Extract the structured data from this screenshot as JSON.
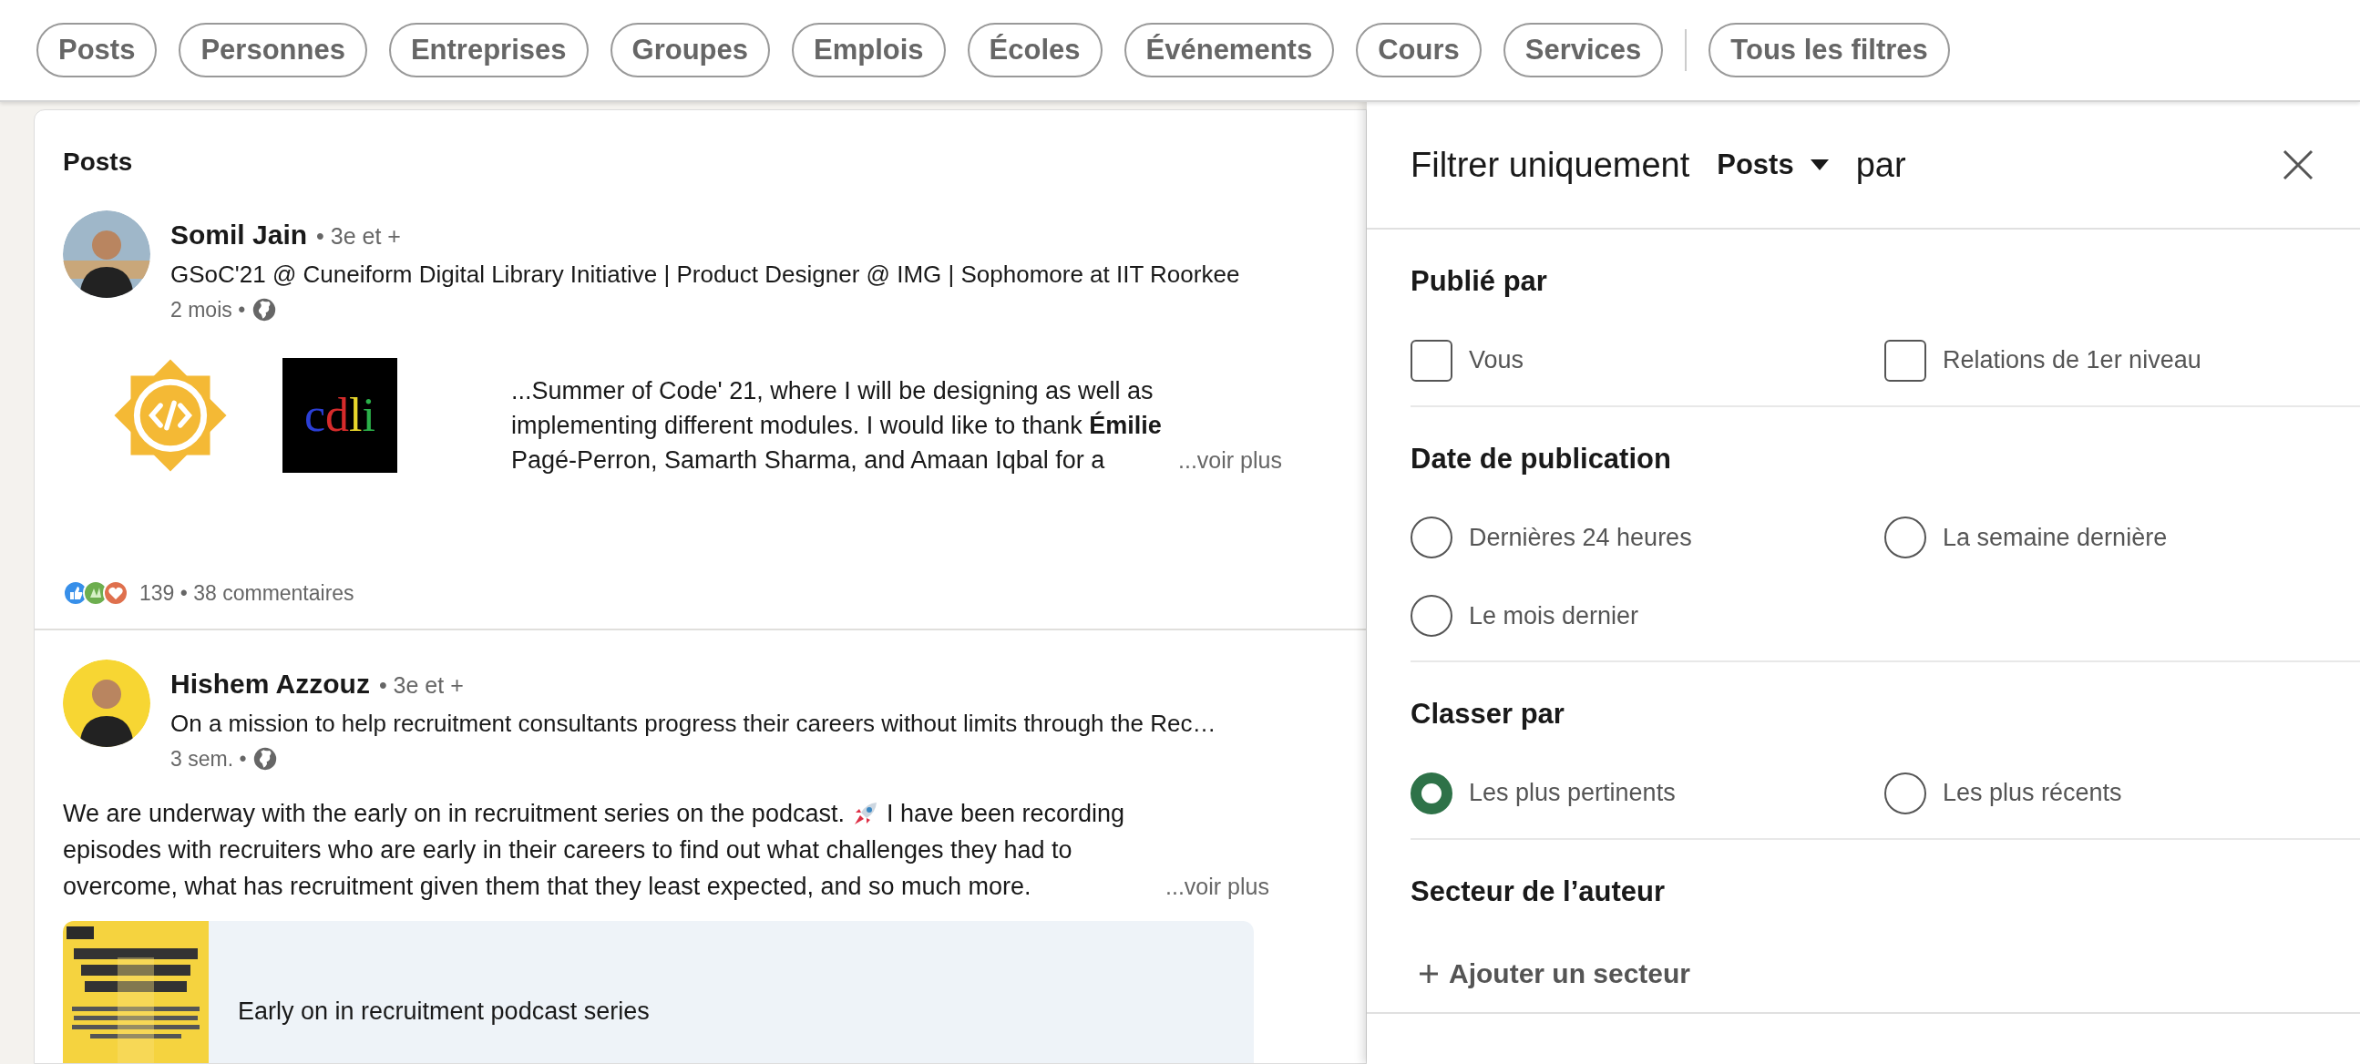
{
  "filter_bar": {
    "pills": [
      "Posts",
      "Personnes",
      "Entreprises",
      "Groupes",
      "Emplois",
      "Écoles",
      "Événements",
      "Cours",
      "Services"
    ],
    "all_filters": "Tous les filtres"
  },
  "results": {
    "heading": "Posts",
    "posts": [
      {
        "kind": "media",
        "author": "Somil Jain",
        "degree": "• 3e et +",
        "headline": "GSoC'21 @ Cuneiform Digital Library Initiative | Product Designer @ IMG | Sophomore at IIT Roorkee",
        "time": "2 mois •",
        "logo_letters": [
          {
            "char": "c",
            "color": "#2b3fd6"
          },
          {
            "char": "d",
            "color": "#d62b2b"
          },
          {
            "char": "l",
            "color": "#e8d62b"
          },
          {
            "char": "i",
            "color": "#2bb04a"
          }
        ],
        "body": "...Summer of Code' 21, where I will be designing as well as implementing different modules. I would like to thank **Émilie**  Pagé-Perron, Samarth Sharma, and Amaan Iqbal for a",
        "more": "...voir plus",
        "social": "139 • 38 commentaires"
      },
      {
        "kind": "link",
        "author": "Hishem Azzouz",
        "degree": "• 3e et +",
        "headline": "On a mission to help recruitment consultants progress their careers without limits through the Rec…",
        "time": "3 sem. •",
        "body": "We are underway with the early on in recruitment series on the podcast.",
        "body_mid": "I have been recording",
        "body_after": "episodes with recruiters who are early in their careers to find out what challenges they had to overcome, what has recruitment given them that they least expected, and so much more.",
        "more": "...voir plus",
        "card_title": "Early on in recruitment podcast series"
      }
    ]
  },
  "filter_panel": {
    "title": "Filtrer uniquement",
    "type_dropdown": "Posts",
    "title_after": "par",
    "sections": [
      {
        "kind": "checkbox",
        "title": "Publié par",
        "options": [
          {
            "label": "Vous",
            "checked": false
          },
          {
            "label": "Relations de 1er niveau",
            "checked": false
          }
        ]
      },
      {
        "kind": "radio",
        "title": "Date de publication",
        "options": [
          {
            "label": "Dernières 24 heures",
            "selected": false
          },
          {
            "label": "La semaine dernière",
            "selected": false
          },
          {
            "label": "Le mois dernier",
            "selected": false
          }
        ]
      },
      {
        "kind": "radio",
        "title": "Classer par",
        "options": [
          {
            "label": "Les plus pertinents",
            "selected": true
          },
          {
            "label": "Les plus récents",
            "selected": false
          }
        ]
      },
      {
        "kind": "add",
        "title": "Secteur de l’auteur",
        "action": "Ajouter un secteur"
      }
    ]
  }
}
